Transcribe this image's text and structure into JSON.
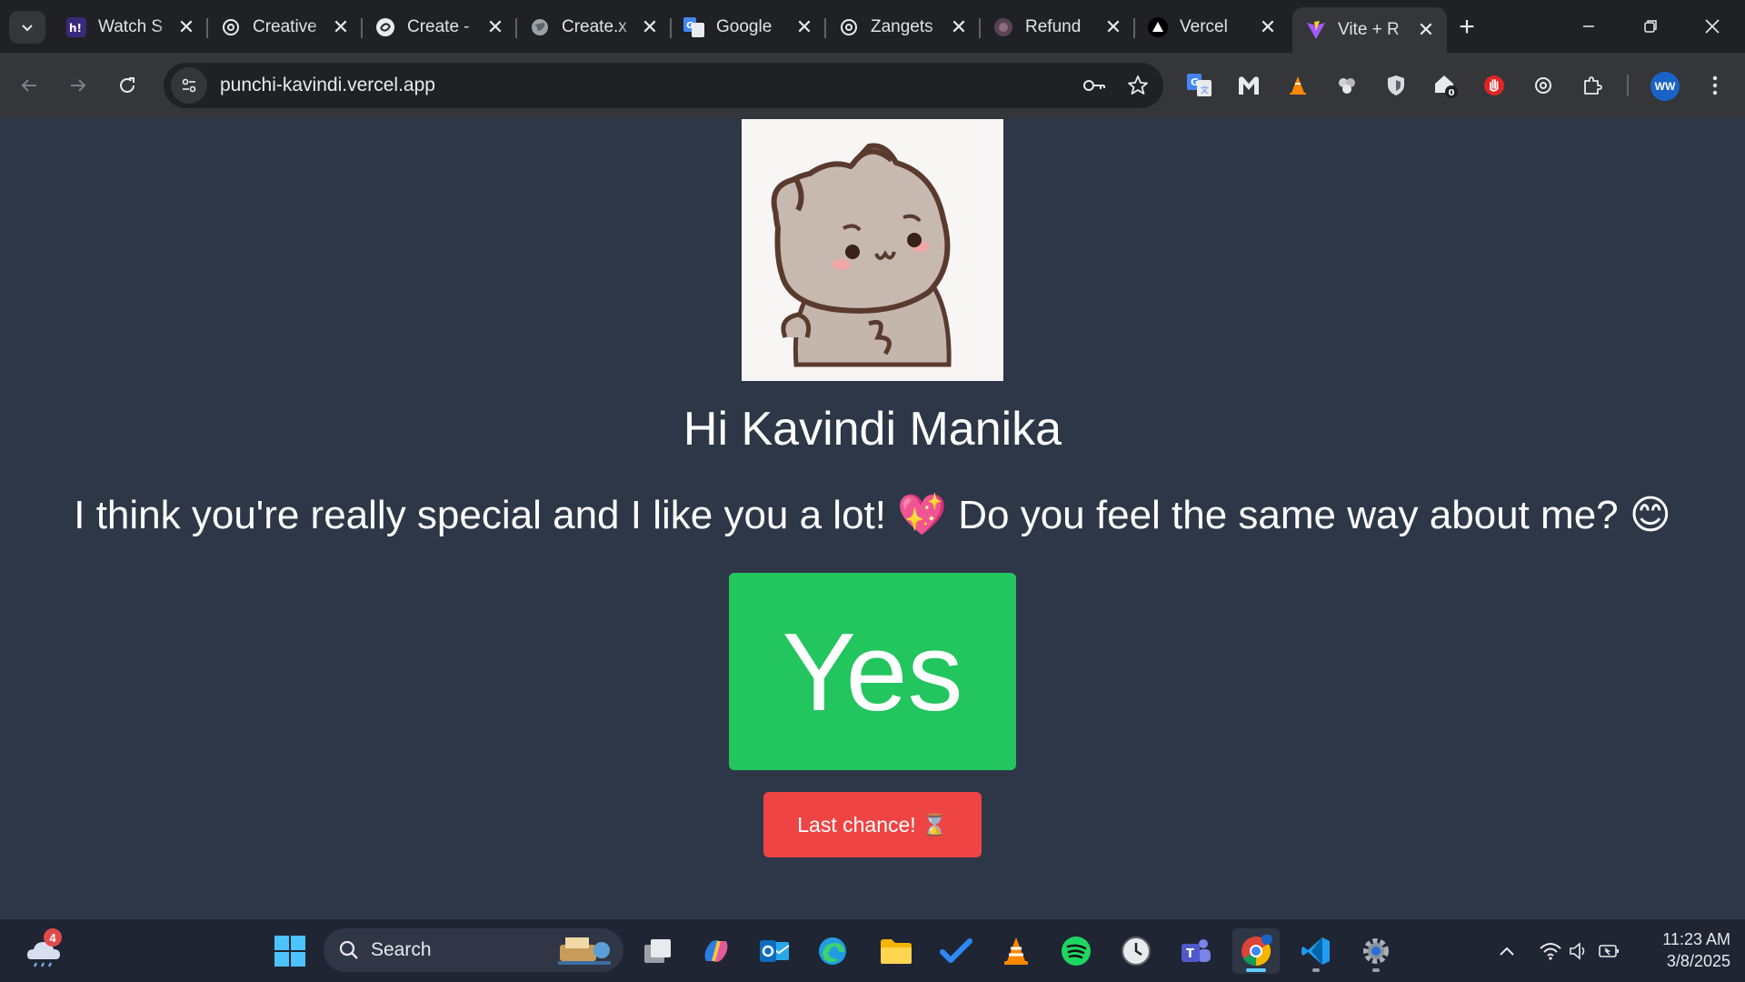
{
  "browser": {
    "tabs": [
      {
        "title": "Watch S",
        "icon": "hianime-icon",
        "active": false
      },
      {
        "title": "Creative",
        "icon": "openai-icon",
        "active": false
      },
      {
        "title": "Create -",
        "icon": "bolt-icon",
        "active": false
      },
      {
        "title": "Create.x",
        "icon": "globe-icon",
        "active": false
      },
      {
        "title": "Google",
        "icon": "google-translate-icon",
        "active": false
      },
      {
        "title": "Zangets",
        "icon": "openai-icon",
        "active": false
      },
      {
        "title": "Refund",
        "icon": "refund-site-icon",
        "active": false
      },
      {
        "title": "Vercel",
        "icon": "vercel-icon",
        "active": false
      },
      {
        "title": "Vite + R",
        "icon": "vite-icon",
        "active": true
      }
    ],
    "url": "punchi-kavindi.vercel.app",
    "profile_initials": "WW",
    "extension_badge": "0"
  },
  "page": {
    "greeting": "Hi Kavindi Manika",
    "question": "I think you're really special and I like you a lot! 💖 Do you feel the same way about me? 😊",
    "yes_label": "Yes",
    "no_label": "Last chance! ⌛",
    "image": "cute-cat-sticker"
  },
  "taskbar": {
    "search_placeholder": "Search",
    "weather_badge": "4",
    "time": "11:23 AM",
    "date": "3/8/2025"
  },
  "colors": {
    "page_bg": "#2e3748",
    "yes_button": "#22c55e",
    "no_button": "#ef4444",
    "tabstrip_bg": "#202124",
    "toolbar_bg": "#35363a"
  }
}
